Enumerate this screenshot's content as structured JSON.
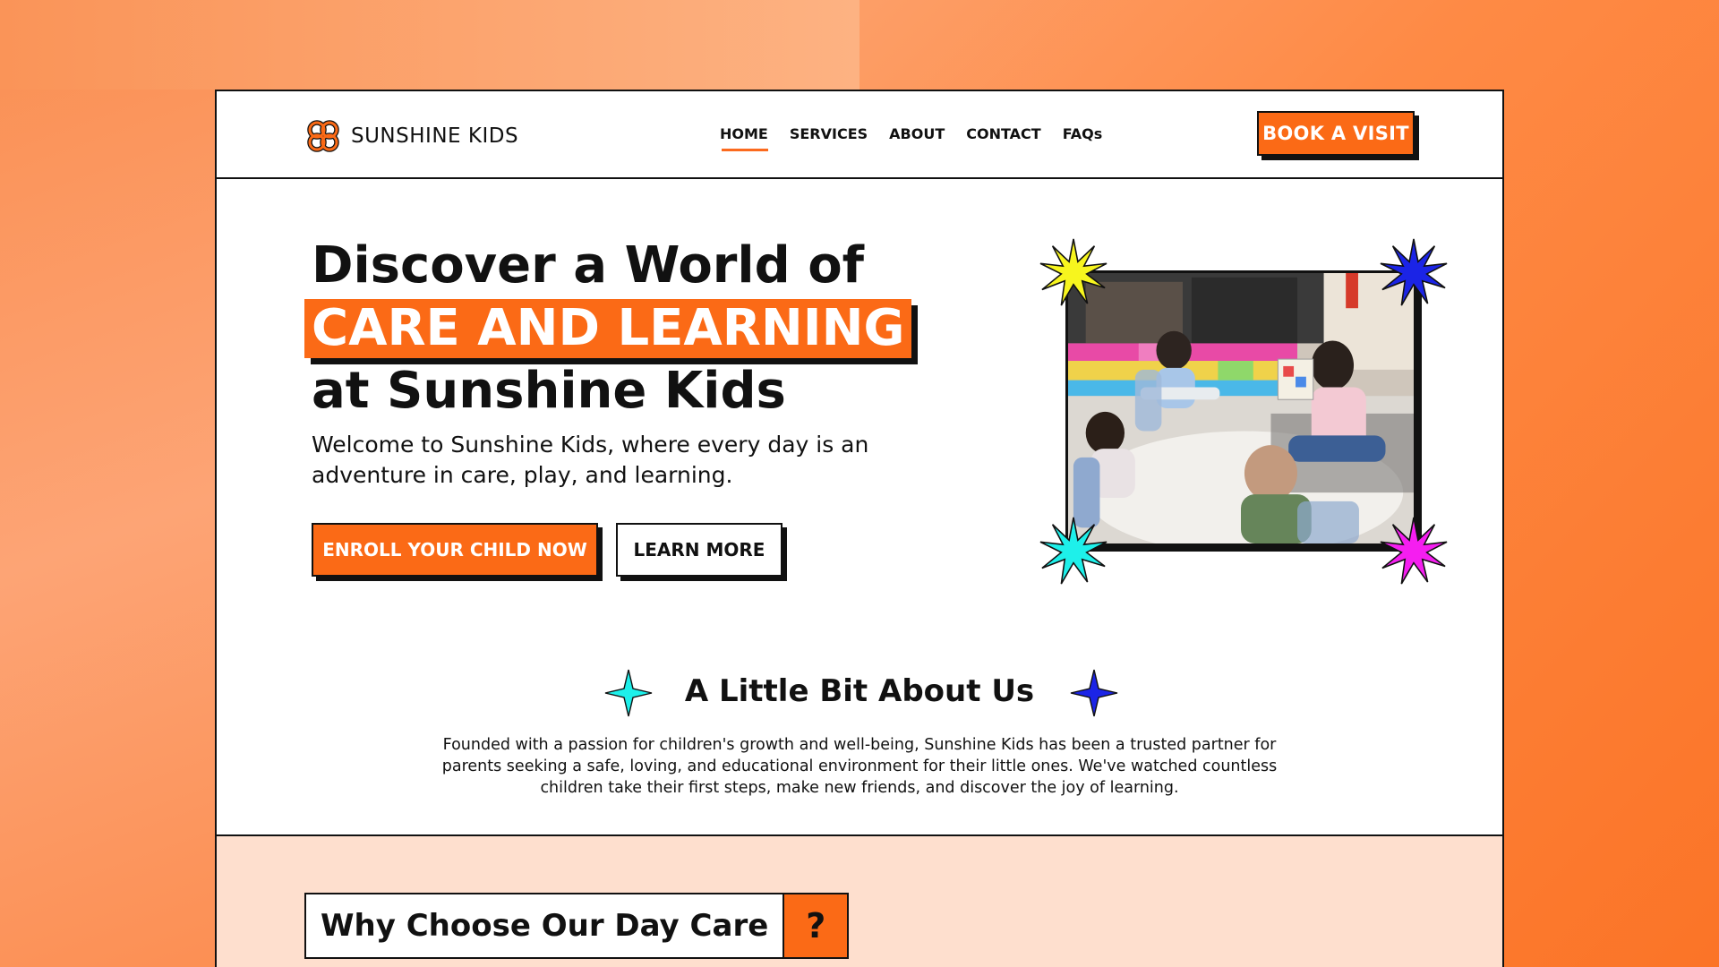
{
  "brand": {
    "name": "SUNSHINE KIDS",
    "accent": "#fb6a16"
  },
  "nav": {
    "items": [
      "HOME",
      "SERVICES",
      "ABOUT",
      "CONTACT",
      "FAQs"
    ],
    "active": "HOME"
  },
  "header": {
    "book_label": "BOOK A VISIT"
  },
  "hero": {
    "line1": "Discover a World of",
    "highlight": "CARE AND LEARNING",
    "line3": "at Sunshine Kids",
    "subtitle": "Welcome to Sunshine Kids, where every day is an adventure in care, play, and learning.",
    "enroll_label": "ENROLL YOUR CHILD NOW",
    "learn_label": "LEARN MORE"
  },
  "decor": {
    "burst_colors": [
      "#f7f51e",
      "#1b24e6",
      "#1ef0ea",
      "#f51ef0"
    ],
    "star_colors": [
      "#1ef0ea",
      "#1b24e6"
    ],
    "icons": [
      "sunshine-logo-icon",
      "sparkle-star-icon",
      "burst-star-icon"
    ]
  },
  "about": {
    "title": "A Little Bit About Us",
    "text": "Founded with a passion for children's growth and well-being, Sunshine Kids has been a trusted partner for parents seeking a safe, loving, and educational environment for their little ones. We've watched countless children take their first steps, make new friends, and discover the joy of learning."
  },
  "why": {
    "title": "Why Choose Our Day Care",
    "mark": "?"
  }
}
